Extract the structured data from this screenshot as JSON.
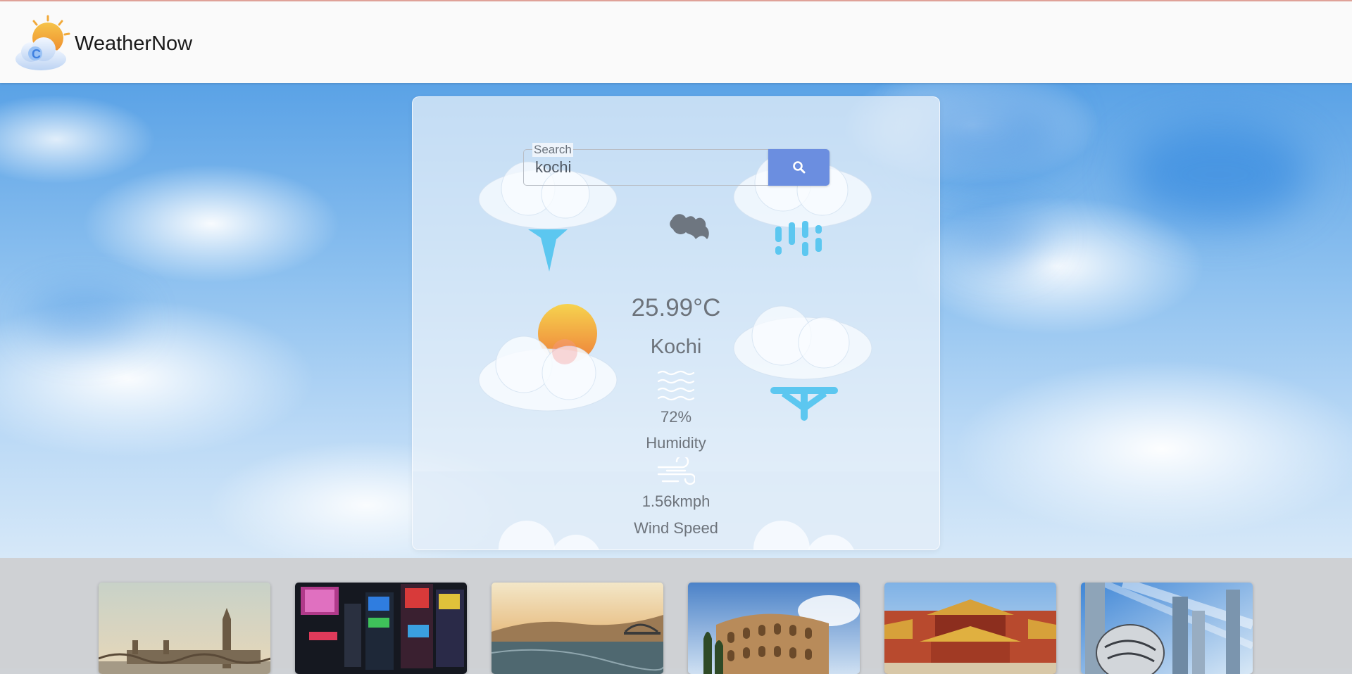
{
  "app": {
    "name": "WeatherNow"
  },
  "search": {
    "legend": "Search",
    "value": "kochi"
  },
  "weather": {
    "temperature": "25.99°C",
    "city": "Kochi",
    "humidity_value": "72%",
    "humidity_label": "Humidity",
    "wind_value": "1.56kmph",
    "wind_label": "Wind Speed"
  },
  "icons": {
    "logo": "sun-cloud-logo-icon",
    "search": "search-icon",
    "storm": "thunder-cloud-icon",
    "bat": "bat-icon",
    "rain": "rain-cloud-icon",
    "sunny": "sun-behind-cloud-icon",
    "snow": "snow-cloud-icon",
    "humidity": "humidity-waves-icon",
    "wind": "wind-icon"
  },
  "destinations": [
    {
      "name": "london-thumbnail"
    },
    {
      "name": "tokyo-thumbnail"
    },
    {
      "name": "porto-thumbnail"
    },
    {
      "name": "rome-colosseum-thumbnail"
    },
    {
      "name": "beijing-forbidden-city-thumbnail"
    },
    {
      "name": "dubai-thumbnail"
    }
  ],
  "colors": {
    "accent": "#6b8ee0",
    "text_muted": "#6d737b",
    "header_bg": "#fafafa",
    "strip_bg": "#cfd1d4"
  }
}
